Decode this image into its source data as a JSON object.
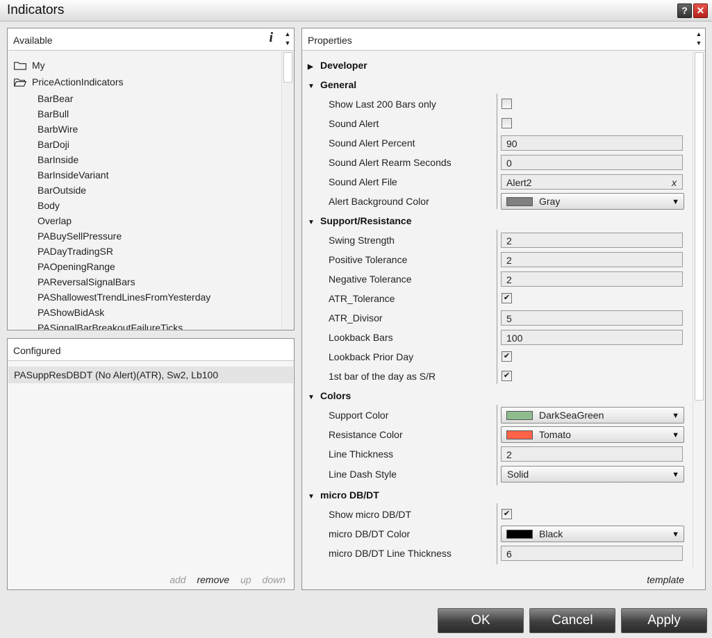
{
  "window": {
    "title": "Indicators"
  },
  "titlebar_buttons": {
    "help": "?",
    "close": "✕"
  },
  "available": {
    "header": "Available",
    "info_icon": "i",
    "folders": [
      "My",
      "PriceActionIndicators"
    ],
    "items": [
      "BarBear",
      "BarBull",
      "BarbWire",
      "BarDoji",
      "BarInside",
      "BarInsideVariant",
      "BarOutside",
      "Body",
      "Overlap",
      "PABuySellPressure",
      "PADayTradingSR",
      "PAOpeningRange",
      "PAReversalSignalBars",
      "PAShallowestTrendLinesFromYesterday",
      "PAShowBidAsk",
      "PASignalBarBreakoutFailureTicks"
    ]
  },
  "configured": {
    "header": "Configured",
    "items": [
      "PASuppResDBDT (No Alert)(ATR),  Sw2,  Lb100"
    ],
    "actions": {
      "add": "add",
      "remove": "remove",
      "up": "up",
      "down": "down"
    }
  },
  "properties": {
    "header": "Properties",
    "categories": {
      "developer": "Developer",
      "general": "General",
      "support_resistance": "Support/Resistance",
      "colors": "Colors",
      "micro": "micro DB/DT"
    },
    "general": {
      "show_last_200": {
        "label": "Show Last 200 Bars only",
        "checked": false
      },
      "sound_alert": {
        "label": "Sound Alert",
        "checked": false
      },
      "sound_alert_percent": {
        "label": "Sound Alert Percent",
        "value": "90"
      },
      "sound_alert_rearm": {
        "label": "Sound Alert Rearm Seconds",
        "value": "0"
      },
      "sound_alert_file": {
        "label": "Sound Alert File",
        "value": "Alert2",
        "clear": "x"
      },
      "alert_bg_color": {
        "label": "Alert Background Color",
        "value": "Gray",
        "swatch": "#808080"
      }
    },
    "support_resistance": {
      "swing_strength": {
        "label": "Swing Strength",
        "value": "2"
      },
      "positive_tolerance": {
        "label": "Positive Tolerance",
        "value": "2"
      },
      "negative_tolerance": {
        "label": "Negative Tolerance",
        "value": "2"
      },
      "atr_tolerance": {
        "label": "ATR_Tolerance",
        "checked": true
      },
      "atr_divisor": {
        "label": "ATR_Divisor",
        "value": "5"
      },
      "lookback_bars": {
        "label": "Lookback Bars",
        "value": "100"
      },
      "lookback_prior_day": {
        "label": "Lookback Prior Day",
        "checked": true
      },
      "first_bar_sr": {
        "label": "1st bar of the day as S/R",
        "checked": true
      }
    },
    "colors": {
      "support_color": {
        "label": "Support Color",
        "value": "DarkSeaGreen",
        "swatch": "#8fbc8f"
      },
      "resistance_color": {
        "label": "Resistance Color",
        "value": "Tomato",
        "swatch": "#ff6347"
      },
      "line_thickness": {
        "label": "Line Thickness",
        "value": "2"
      },
      "line_dash_style": {
        "label": "Line Dash Style",
        "value": "Solid"
      }
    },
    "micro": {
      "show_micro": {
        "label": "Show micro DB/DT",
        "checked": true
      },
      "micro_color": {
        "label": "micro DB/DT Color",
        "value": "Black",
        "swatch": "#000000"
      },
      "micro_thickness": {
        "label": "micro DB/DT Line Thickness",
        "value": "6"
      }
    },
    "template": "template"
  },
  "buttons": {
    "ok": "OK",
    "cancel": "Cancel",
    "apply": "Apply"
  },
  "check_glyph": "✔"
}
